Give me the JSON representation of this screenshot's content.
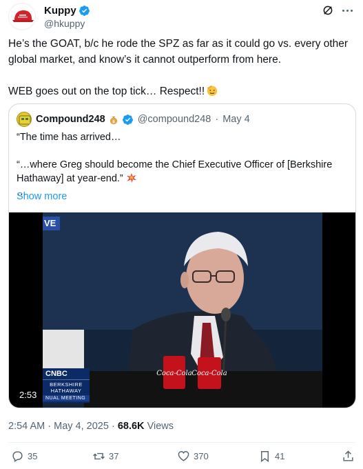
{
  "author": {
    "display_name": "Kuppy",
    "handle": "@hkuppy",
    "verified": true,
    "avatar_color": "#d0262b"
  },
  "tweet": {
    "paragraph_1": "He’s the GOAT, b/c he rode the SPZ as far as it could go vs. every other global market, and know’s it cannot outperform from here.",
    "paragraph_2": "WEB goes out on the top tick… Respect!!"
  },
  "quote": {
    "display_name": "Compound248",
    "handle": "@compound248",
    "date": "May 4",
    "separator": "·",
    "line_1": "“The time has arrived…",
    "line_2": "“…where Greg should become the Chief Executive Officer of [Berkshire Hathaway] at year-end.”",
    "line_3": "…",
    "show_more": "Show more",
    "video": {
      "live_label": "VE",
      "duration": "2:53",
      "cnbc": "CNBC",
      "berkshire_line_1": "BERKSHIRE",
      "berkshire_line_2": "HATHAWAY",
      "meeting_label": "NUAL MEETING",
      "can_label": "Coca-Cola"
    }
  },
  "meta": {
    "time": "2:54 AM",
    "date": "May 4, 2025",
    "separator": "·",
    "views_count": "68.6K",
    "views_label": "Views"
  },
  "actions": {
    "replies": "35",
    "reposts": "37",
    "likes": "370",
    "bookmarks": "41"
  },
  "colors": {
    "accent": "#1d9bf0",
    "muted": "#536471",
    "border": "#cfd9de"
  }
}
